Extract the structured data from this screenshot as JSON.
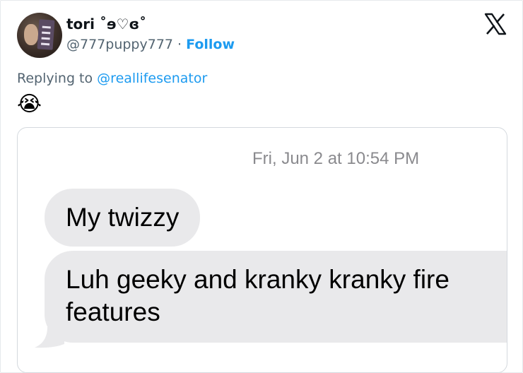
{
  "user": {
    "display_name": "tori ˚ɘ♡ɞ˚",
    "handle": "@777puppy777",
    "separator": "·",
    "follow_label": "Follow"
  },
  "reply": {
    "prefix": "Replying to",
    "mention": "@reallifesenator"
  },
  "tweet": {
    "emoji": "😭"
  },
  "media": {
    "timestamp": "Fri, Jun 2 at 10:54 PM",
    "messages": [
      {
        "text": "My twizzy"
      },
      {
        "line1": "Luh geeky and kranky kranky fire",
        "line2": "features"
      }
    ]
  },
  "colors": {
    "accent": "#1d9bf0",
    "bubble": "#e9e9eb",
    "secondary_text": "#536471"
  },
  "icons": {
    "platform_logo": "x-logo-icon"
  }
}
